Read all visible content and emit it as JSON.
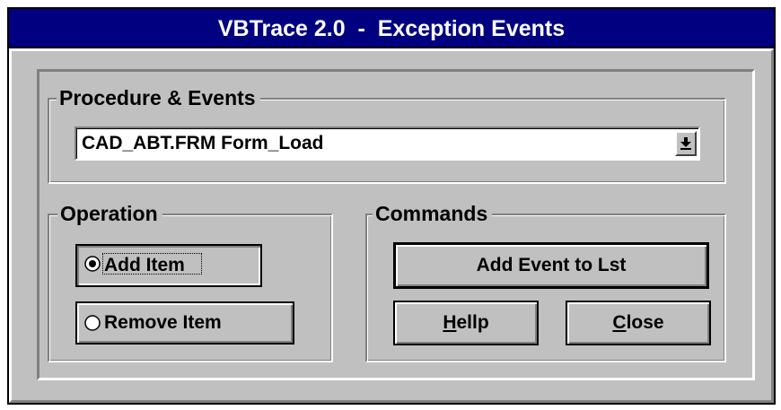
{
  "window": {
    "title": "VBTrace 2.0  -  Exception Events"
  },
  "procedure_group": {
    "label": "Procedure & Events",
    "combo_value": "CAD_ABT.FRM Form_Load",
    "combo_button_icon": "dropdown-arrow-icon"
  },
  "operation_group": {
    "label": "Operation",
    "options": [
      {
        "label": "Add Item",
        "selected": true
      },
      {
        "label": "Remove Item",
        "selected": false
      }
    ]
  },
  "commands_group": {
    "label": "Commands",
    "add_event_label": "Add Event to Lst",
    "help_label": "Hellp",
    "close_label": "Close"
  },
  "colors": {
    "title_bar": "#000080",
    "face": "#c0c0c0",
    "highlight": "#ffffff",
    "shadow": "#808080"
  }
}
